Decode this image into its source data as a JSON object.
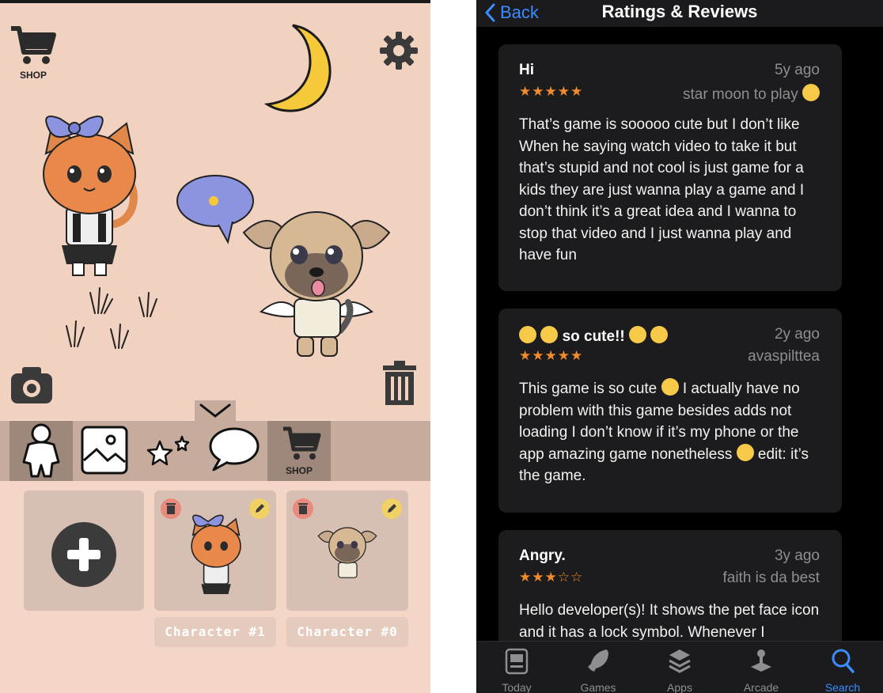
{
  "game": {
    "shop_label": "SHOP",
    "tab_shop_label": "SHOP",
    "characters": [
      {
        "name": "Character #1"
      },
      {
        "name": "Character #0"
      }
    ]
  },
  "reviews_screen": {
    "nav": {
      "back_label": "Back",
      "title": "Ratings & Reviews"
    },
    "reviews": [
      {
        "title": "Hi",
        "date": "5y ago",
        "stars": "★★★★★",
        "rating": 5,
        "author": "star moon to play",
        "body": "That’s game is sooooo cute but I don’t like When he saying watch video to take it but that’s stupid and not cool is just game for a kids they are just wanna play a game and I don’t think it’s a great idea and I wanna to stop that video and I just wanna play and have fun"
      },
      {
        "title": "so cute!!",
        "date": "2y ago",
        "stars": "★★★★★",
        "rating": 5,
        "author": "avaspilttea",
        "body_1": "This game is so cute",
        "body_2": "I actually have no problem with this game besides adds not loading I don’t know if it’s my phone or the app amazing game nonetheless",
        "body_3": "edit: it’s the game."
      },
      {
        "title": "Angry.",
        "date": "3y ago",
        "stars": "★★★☆☆",
        "rating": 3,
        "author": "faith is da best",
        "body": "Hello developer(s)! It shows the pet face icon and it has a lock symbol. Whenever I"
      }
    ],
    "tabbar": [
      {
        "label": "Today",
        "icon": "today-icon"
      },
      {
        "label": "Games",
        "icon": "rocket-icon"
      },
      {
        "label": "Apps",
        "icon": "layers-icon"
      },
      {
        "label": "Arcade",
        "icon": "joystick-icon"
      },
      {
        "label": "Search",
        "icon": "search-icon",
        "active": true
      }
    ],
    "colors": {
      "accent": "#3b8cff",
      "star": "#f08c2e",
      "card": "#1c1c1e"
    }
  }
}
